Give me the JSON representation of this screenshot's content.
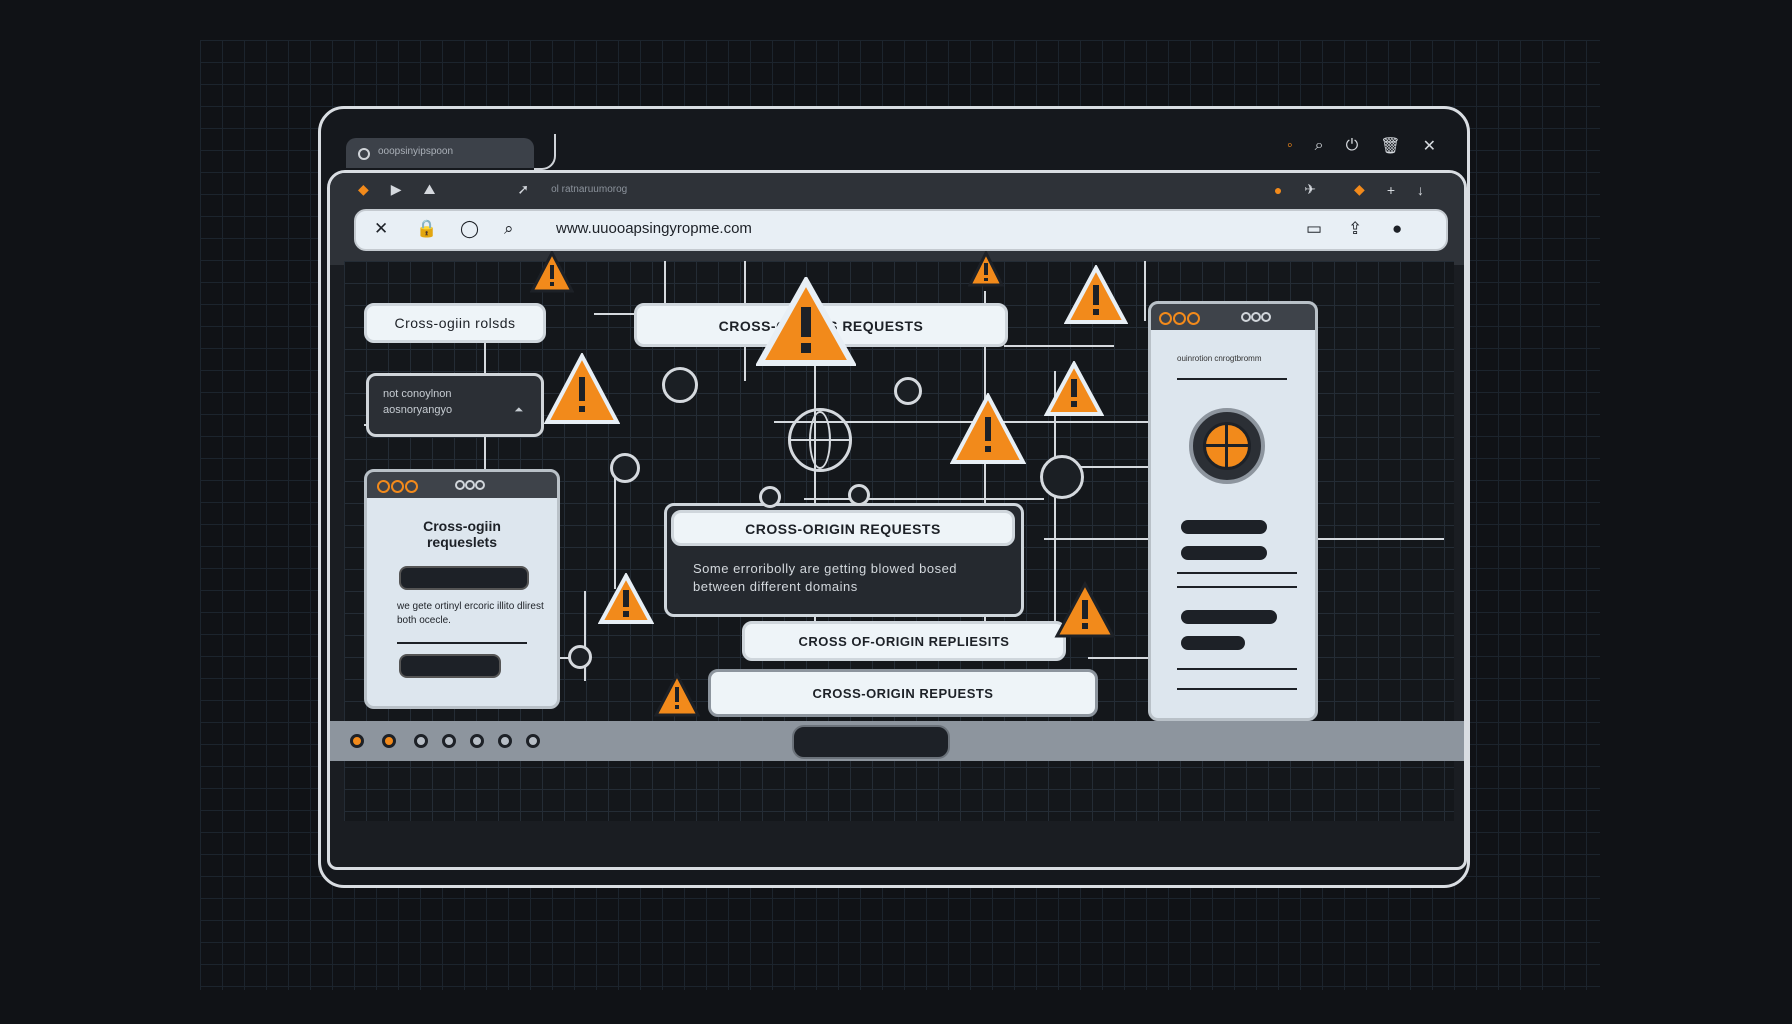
{
  "browser": {
    "tab_label": "ooopsinyipspoon",
    "url": "www.uuooapsingyropme.com",
    "toolbar_faint_text": "ol ratnaruumorog"
  },
  "content": {
    "top_left_pill": "Cross-ogiin rolsds",
    "top_center_pill": "CROSS-ORIN     NS REQUESTS",
    "dark_box_line1": "not conoylnon",
    "dark_box_line2": "aosnoryangyo",
    "left_panel_title": "Cross-ogiin requeslets",
    "left_panel_text": "we gete ortinyl ercoric illito dlirest both ocecle.",
    "center_card_title": "CROSS-ORIGIN REQUESTS",
    "center_card_text": "Some erroribolly are getting blowed bosed between different domains",
    "bottom_pill_1": "CROSS OF-ORIGIN REPLIESITS",
    "bottom_pill_2": "CROSS-ORIGIN REPUESTS",
    "right_panel_text": "ouinrotion cnrogtbromm"
  },
  "colors": {
    "accent": "#f28a1b",
    "frame": "#d9dde2",
    "background": "#101216"
  }
}
